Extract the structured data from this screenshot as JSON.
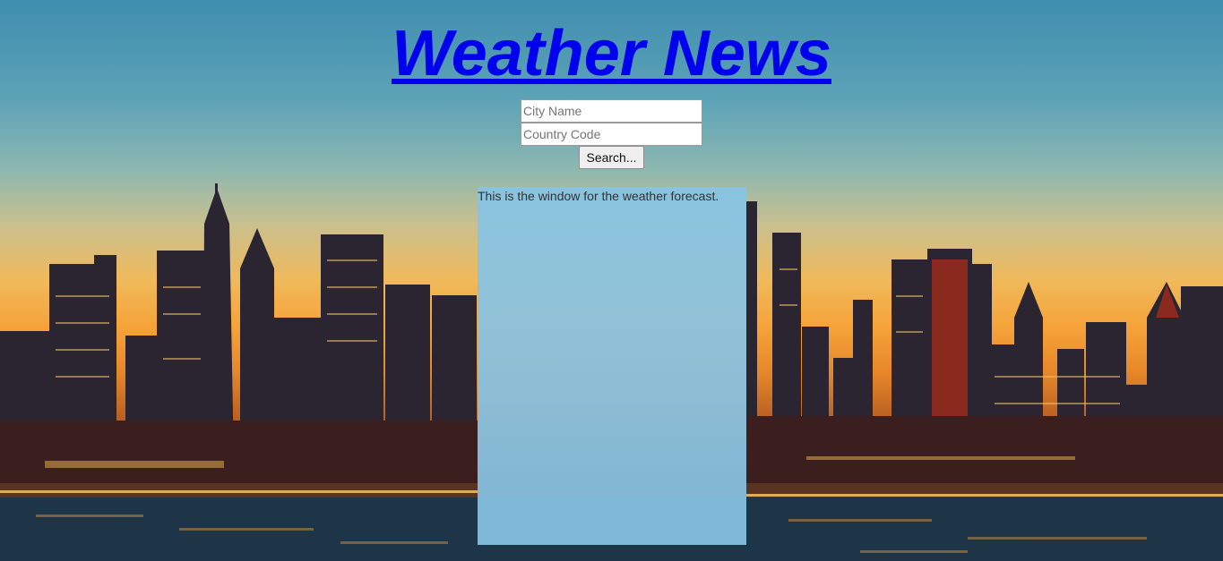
{
  "header": {
    "title": "Weather News"
  },
  "search_form": {
    "city": {
      "value": "",
      "placeholder": "City Name"
    },
    "country": {
      "value": "",
      "placeholder": "Country Code"
    },
    "submit_label": "Search..."
  },
  "forecast_window": {
    "text": "This is the window for the weather forecast."
  },
  "colors": {
    "title_link": "#0000ee",
    "forecast_bg": "#87c3e4"
  }
}
